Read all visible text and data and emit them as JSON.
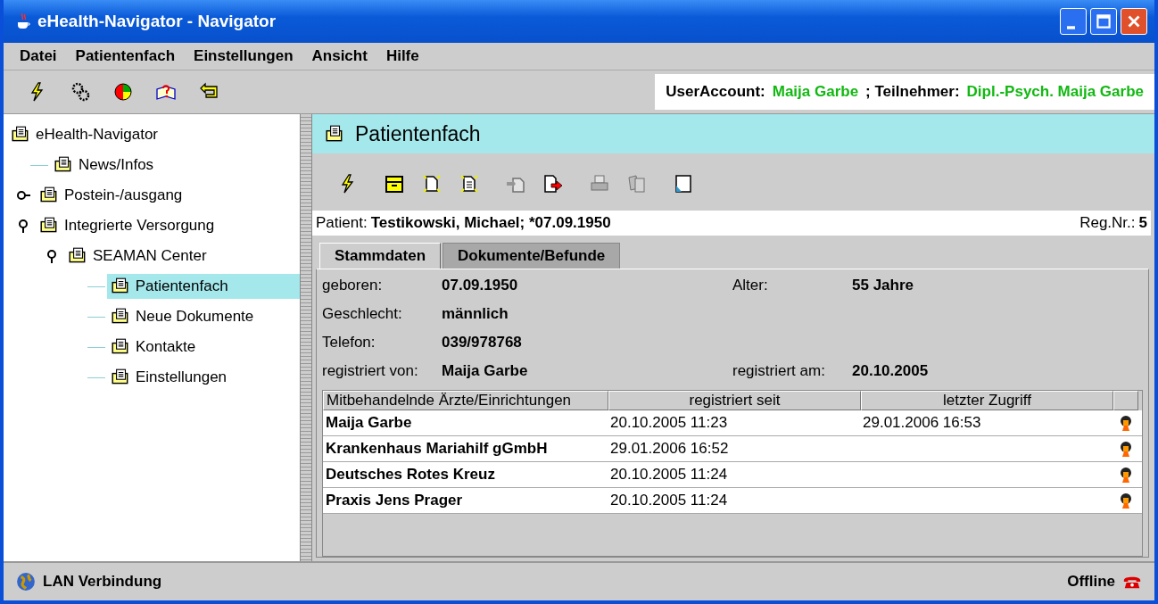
{
  "window": {
    "title": "eHealth-Navigator - Navigator"
  },
  "menu": [
    "Datei",
    "Patientenfach",
    "Einstellungen",
    "Ansicht",
    "Hilfe"
  ],
  "user_info": {
    "account_label": "UserAccount:",
    "account": "Maija Garbe",
    "participant_label": "; Teilnehmer:",
    "participant": "Dipl.-Psych. Maija Garbe"
  },
  "tree": [
    {
      "label": "eHealth-Navigator",
      "selected": false,
      "children": [
        {
          "label": "News/Infos",
          "selected": false
        },
        {
          "label": "Postein-/ausgang",
          "selected": false,
          "expanded": false
        },
        {
          "label": "Integrierte Versorgung",
          "selected": false,
          "expanded": true,
          "children": [
            {
              "label": "SEAMAN Center",
              "selected": false,
              "expanded": true,
              "children": [
                {
                  "label": "Patientenfach",
                  "selected": true
                },
                {
                  "label": "Neue Dokumente",
                  "selected": false
                },
                {
                  "label": "Kontakte",
                  "selected": false
                },
                {
                  "label": "Einstellungen",
                  "selected": false
                }
              ]
            }
          ]
        }
      ]
    }
  ],
  "panel": {
    "title": "Patientenfach",
    "toolbar": [
      {
        "disabled": false
      },
      {
        "disabled": false
      },
      {
        "disabled": false
      },
      {
        "disabled": false
      },
      {
        "disabled": true
      },
      {
        "disabled": false
      },
      {
        "disabled": true
      },
      {
        "disabled": true
      },
      {
        "disabled": false
      }
    ],
    "patient": {
      "label": "Patient:",
      "value": "Testikowski, Michael; *07.09.1950",
      "reg_label": "Reg.Nr.:",
      "reg": "5"
    },
    "tabs": [
      {
        "label": "Stammdaten",
        "selected": true
      },
      {
        "label": "Dokumente/Befunde",
        "selected": false
      }
    ],
    "fields": [
      {
        "left": {
          "label": "geboren:",
          "value": "07.09.1950"
        },
        "right": {
          "label": "Alter:",
          "value": "55 Jahre"
        }
      },
      {
        "left": {
          "label": "Geschlecht:",
          "value": "männlich"
        }
      },
      {
        "left": {
          "label": "Telefon:",
          "value": "039/978768"
        }
      },
      {
        "left": {
          "label": "registriert von:",
          "value": "Maija Garbe"
        },
        "right": {
          "label": "registriert am:",
          "value": "20.10.2005"
        }
      }
    ],
    "table": {
      "columns": [
        "Mitbehandelnde Ärzte/Einrichtungen",
        "registriert seit",
        "letzter Zugriff"
      ],
      "rows": [
        {
          "name": "Maija Garbe",
          "since": "20.10.2005  11:23",
          "last": "29.01.2006  16:53"
        },
        {
          "name": "Krankenhaus Mariahilf gGmbH",
          "since": "29.01.2006  16:52"
        },
        {
          "name": "Deutsches Rotes Kreuz",
          "since": "20.10.2005  11:24"
        },
        {
          "name": "Praxis Jens Prager",
          "since": "20.10.2005  11:24"
        }
      ]
    }
  },
  "status_bar": {
    "connection": "LAN Verbindung",
    "state": "Offline"
  }
}
